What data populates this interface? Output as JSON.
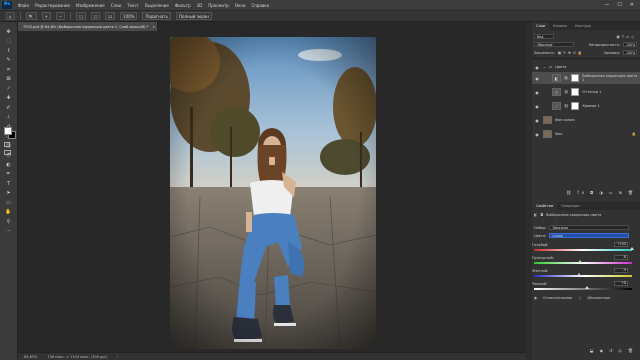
{
  "app": {
    "logo": "Ps"
  },
  "menu": [
    "Файл",
    "Редактирование",
    "Изображение",
    "Слои",
    "Текст",
    "Выделение",
    "Фильтр",
    "3D",
    "Просмотр",
    "Окно",
    "Справка"
  ],
  "window_controls": {
    "minimize": "—",
    "maximize": "☐",
    "close": "✕"
  },
  "options_bar": {
    "zoom": "100%",
    "fit_screen": "Подогнать",
    "fill_screen": "Полный экран"
  },
  "document": {
    "tab_title": "7503.psd @ 84,6% (Выборочная коррекция цвета 1, Слой-маска/8) *",
    "tab_close": "×"
  },
  "status": {
    "zoom": "84,63%",
    "size": "736 пикс. × 1104 пикс. (300 ppi)"
  },
  "panels": {
    "tabs": [
      "Слои",
      "Каналы",
      "Контуры"
    ],
    "kind_label": "Вид",
    "blend_mode": "Обычные",
    "opacity_label": "Непрозрачность:",
    "opacity_value": "100%",
    "lock_label": "Закрепить:",
    "fill_label": "Заливка:",
    "fill_value": "100%",
    "layers": [
      {
        "name": "Цвета",
        "type": "group",
        "icon": "folder-icon"
      },
      {
        "name": "Выборочная коррекция цвета 1",
        "type": "adjustment",
        "icon": "selective-color-icon",
        "selected": true
      },
      {
        "name": "Оттенки 1",
        "type": "adjustment",
        "icon": "vibrance-icon"
      },
      {
        "name": "Кривые 1",
        "type": "adjustment",
        "icon": "curves-icon"
      },
      {
        "name": "Фон копия",
        "type": "pixel",
        "icon": "photo-thumb"
      },
      {
        "name": "Фон",
        "type": "pixel",
        "icon": "photo-thumb"
      }
    ]
  },
  "properties": {
    "tabs": [
      "Свойства",
      "Операции"
    ],
    "title": "Выборочная коррекция цвета",
    "preset_label": "Набор:",
    "preset_value": "Заказная",
    "colors_label": "Цвета:",
    "colors_value": "Синие",
    "sliders": [
      {
        "label": "Голубой:",
        "value": "+100",
        "fraction": 1.0
      },
      {
        "label": "Пурпурный:",
        "value": "-6",
        "fraction": 0.47
      },
      {
        "label": "Желтый:",
        "value": "-9",
        "fraction": 0.455
      },
      {
        "label": "Черный:",
        "value": "+8",
        "fraction": 0.54
      }
    ],
    "mode_relative": "Относительные",
    "mode_absolute": "Абсолютные",
    "units": "%"
  }
}
